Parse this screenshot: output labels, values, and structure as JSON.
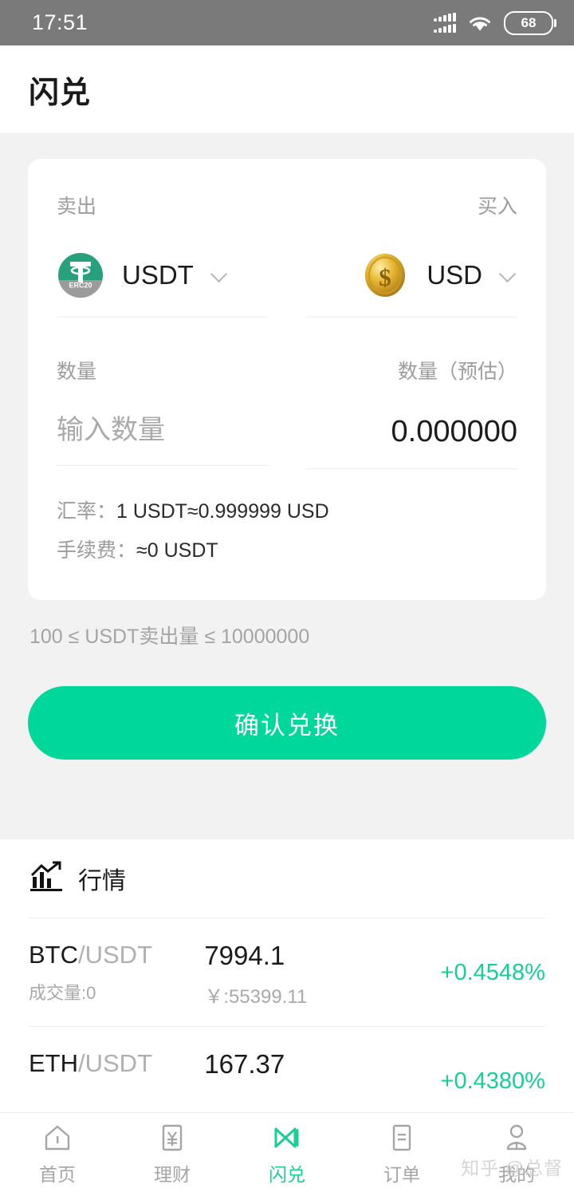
{
  "status_bar": {
    "time": "17:51",
    "battery_level": "68",
    "signal_icon": "signal-bars-icon",
    "wifi_icon": "wifi-icon"
  },
  "header": {
    "title": "闪兑"
  },
  "exchange_card": {
    "sell_label": "卖出",
    "buy_label": "买入",
    "sell_coin": {
      "symbol": "USDT",
      "icon": "tether-erc20-icon",
      "icon_badge": "ERC20",
      "icon_letter": "T"
    },
    "buy_coin": {
      "symbol": "USD",
      "icon": "gold-coin-dollar-icon",
      "icon_letter": "$"
    },
    "amount_label": "数量",
    "amount_estimated_label": "数量（预估）",
    "amount_placeholder": "输入数量",
    "amount_value": "",
    "estimated_value": "0.000000",
    "rate_line": "汇率：1 USDT≈0.999999 USD",
    "rate_label": "汇率：",
    "rate_value": "1 USDT≈0.999999 USD",
    "fee_label": "手续费：",
    "fee_value": "≈0 USDT"
  },
  "limit_text": "100 ≤ USDT卖出量 ≤ 10000000",
  "confirm_button": "确认兑换",
  "market": {
    "title": "行情",
    "icon": "chart-trending-up-icon",
    "rows": [
      {
        "base": "BTC",
        "quote": "/USDT",
        "volume": "成交量:0",
        "price": "7994.1",
        "cny": "￥:55399.11",
        "change": "+0.4548%"
      },
      {
        "base": "ETH",
        "quote": "/USDT",
        "volume": "",
        "price": "167.37",
        "cny": "",
        "change": "+0.4380%"
      }
    ]
  },
  "tabbar": {
    "items": [
      {
        "label": "首页",
        "icon": "home-icon",
        "active": false
      },
      {
        "label": "理财",
        "icon": "yuan-document-icon",
        "active": false
      },
      {
        "label": "闪兑",
        "icon": "flash-exchange-icon",
        "active": true
      },
      {
        "label": "订单",
        "icon": "order-list-icon",
        "active": false
      },
      {
        "label": "我的",
        "icon": "user-profile-icon",
        "active": false
      }
    ]
  },
  "watermark": "知乎 @总督",
  "colors": {
    "accent_green": "#00d79b",
    "change_green": "#17cf94",
    "status_bar": "#7a7a7a",
    "page_bg": "#f2f2f2"
  }
}
